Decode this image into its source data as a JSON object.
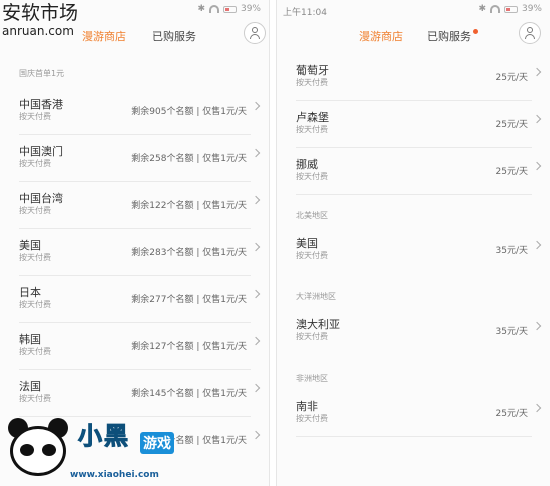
{
  "watermark": {
    "title": "安软市场",
    "url": "anruan.com",
    "brand": "小黑",
    "brand_suffix": "游戏",
    "brand_url": "www.xiaohei.com"
  },
  "left_phone": {
    "status": {
      "battery_pct": "39%"
    },
    "tabs": {
      "shop": "漫游商店",
      "purchased": "已购服务"
    },
    "section_label": "国庆首单1元",
    "items": [
      {
        "name": "中国香港",
        "sub": "按天付费",
        "info": "剩余905个名额 | 仅售1元/天"
      },
      {
        "name": "中国澳门",
        "sub": "按天付费",
        "info": "剩余258个名额 | 仅售1元/天"
      },
      {
        "name": "中国台湾",
        "sub": "按天付费",
        "info": "剩余122个名额 | 仅售1元/天"
      },
      {
        "name": "美国",
        "sub": "按天付费",
        "info": "剩余283个名额 | 仅售1元/天"
      },
      {
        "name": "日本",
        "sub": "按天付费",
        "info": "剩余277个名额 | 仅售1元/天"
      },
      {
        "name": "韩国",
        "sub": "按天付费",
        "info": "剩余127个名额 | 仅售1元/天"
      },
      {
        "name": "法国",
        "sub": "按天付费",
        "info": "剩余145个名额 | 仅售1元/天"
      },
      {
        "name": "",
        "sub": "",
        "info": "157个名额 | 仅售1元/天"
      }
    ]
  },
  "right_phone": {
    "status": {
      "time": "上午11:04",
      "battery_pct": "39%"
    },
    "tabs": {
      "shop": "漫游商店",
      "purchased": "已购服务"
    },
    "items_top": [
      {
        "name": "葡萄牙",
        "sub": "按天付费",
        "info": "25元/天"
      },
      {
        "name": "卢森堡",
        "sub": "按天付费",
        "info": "25元/天"
      },
      {
        "name": "挪威",
        "sub": "按天付费",
        "info": "25元/天"
      }
    ],
    "section_north_america": "北美地区",
    "items_na": [
      {
        "name": "美国",
        "sub": "按天付费",
        "info": "35元/天"
      }
    ],
    "section_oceania": "大洋洲地区",
    "items_oc": [
      {
        "name": "澳大利亚",
        "sub": "按天付费",
        "info": "35元/天"
      }
    ],
    "section_africa": "非洲地区",
    "items_af": [
      {
        "name": "南非",
        "sub": "按天付费",
        "info": "25元/天"
      }
    ]
  },
  "colors": {
    "accent": "#f0802f",
    "notification_dot": "#f0602f",
    "watermark_blue": "#1a8fd8"
  },
  "icons": {
    "user": "user-icon",
    "chevron": "chevron-right-icon",
    "wifi": "wifi-icon",
    "battery": "battery-icon",
    "bluetooth": "bluetooth-icon"
  }
}
